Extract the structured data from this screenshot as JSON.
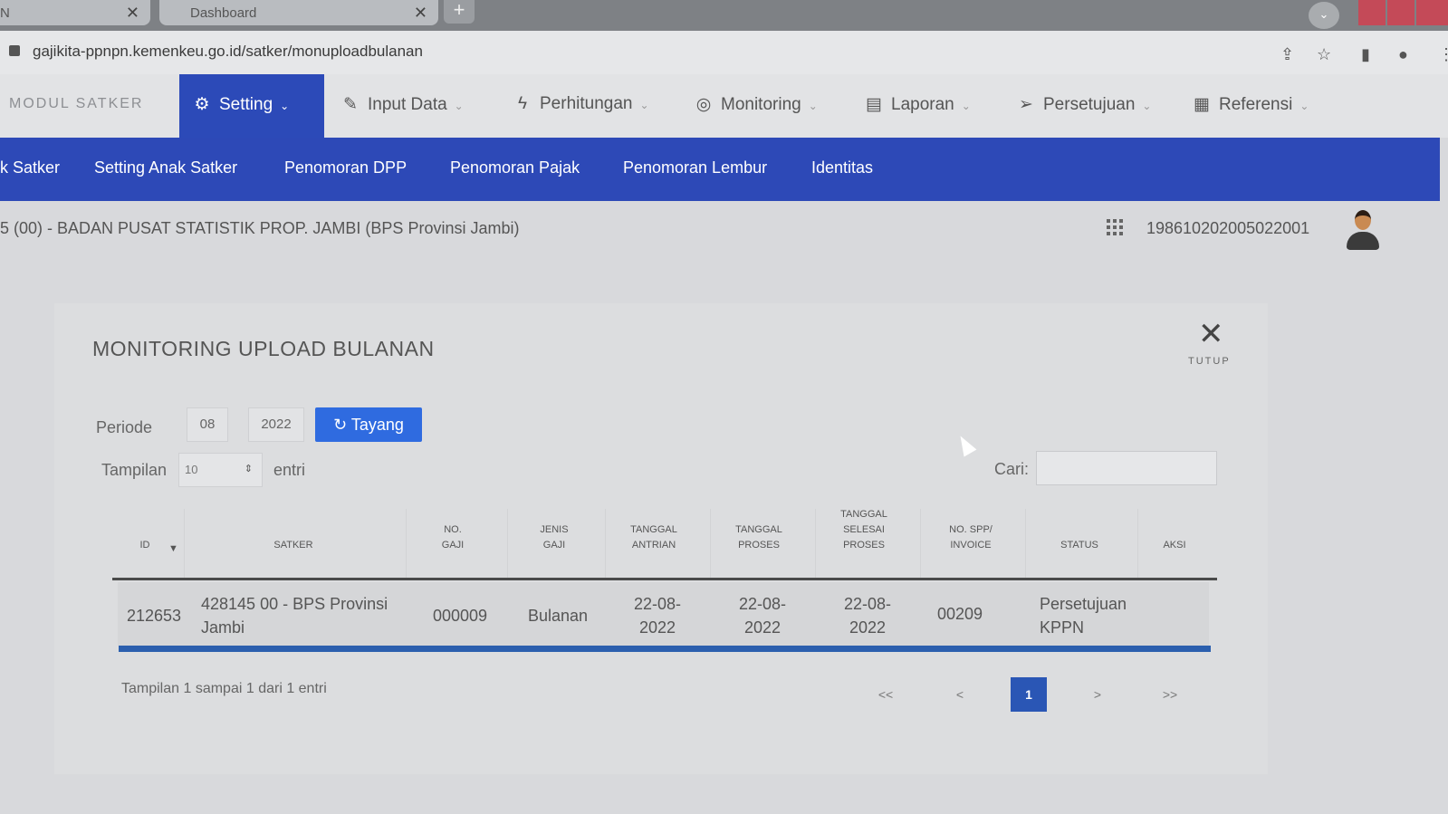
{
  "browser": {
    "tabs": [
      {
        "label": "N"
      },
      {
        "label": "Dashboard"
      }
    ],
    "url": "gajikita-ppnpn.kemenkeu.go.id/satker/monuploadbulanan"
  },
  "mainnav": {
    "brand": "MODUL SATKER",
    "items": [
      {
        "label": "Setting"
      },
      {
        "label": "Input Data"
      },
      {
        "label": "Perhitungan"
      },
      {
        "label": "Monitoring"
      },
      {
        "label": "Laporan"
      },
      {
        "label": "Persetujuan"
      },
      {
        "label": "Referensi"
      }
    ]
  },
  "subnav": {
    "items": [
      {
        "label": "k Satker"
      },
      {
        "label": "Setting Anak Satker"
      },
      {
        "label": "Penomoran DPP"
      },
      {
        "label": "Penomoran Pajak"
      },
      {
        "label": "Penomoran Lembur"
      },
      {
        "label": "Identitas"
      }
    ]
  },
  "info": {
    "satker": "5 (00) - BADAN PUSAT STATISTIK PROP. JAMBI (BPS Provinsi Jambi)",
    "nip": "198610202005022001"
  },
  "modal": {
    "title": "MONITORING UPLOAD BULANAN",
    "close_label": "TUTUP",
    "periode_label": "Periode",
    "bulan": "08",
    "tahun": "2022",
    "tayang_label": "Tayang",
    "tampilan_label": "Tampilan",
    "tampilan_value": "10",
    "entri_label": "entri",
    "cari_label": "Cari:",
    "search_value": ""
  },
  "table": {
    "headers": [
      {
        "l1": "",
        "l2": "",
        "l3": "ID"
      },
      {
        "l1": "",
        "l2": "",
        "l3": "SATKER"
      },
      {
        "l1": "",
        "l2": "NO.",
        "l3": "GAJI"
      },
      {
        "l1": "",
        "l2": "JENIS",
        "l3": "GAJI"
      },
      {
        "l1": "",
        "l2": "TANGGAL",
        "l3": "ANTRIAN"
      },
      {
        "l1": "",
        "l2": "TANGGAL",
        "l3": "PROSES"
      },
      {
        "l1": "TANGGAL",
        "l2": "SELESAI",
        "l3": "PROSES"
      },
      {
        "l1": "",
        "l2": "NO. SPP/",
        "l3": "INVOICE"
      },
      {
        "l1": "",
        "l2": "",
        "l3": "STATUS"
      },
      {
        "l1": "",
        "l2": "",
        "l3": "AKSI"
      }
    ],
    "rows": [
      {
        "id": "212653",
        "satker_1": "428145 00 - BPS Provinsi",
        "satker_2": "Jambi",
        "no_gaji": "000009",
        "jenis_gaji": "Bulanan",
        "tgl_antrian_1": "22-08-",
        "tgl_antrian_2": "2022",
        "tgl_proses_1": "22-08-",
        "tgl_proses_2": "2022",
        "tgl_selesai_1": "22-08-",
        "tgl_selesai_2": "2022",
        "no_spp": "00209",
        "status_1": "Persetujuan",
        "status_2": "KPPN",
        "aksi": ""
      }
    ]
  },
  "footer": {
    "info": "Tampilan 1 sampai 1 dari 1 entri",
    "pagination": {
      "first": "<<",
      "prev": "<",
      "current": "1",
      "next": ">",
      "last": ">>"
    }
  },
  "colors": {
    "primary_nav": "#2d49b7",
    "button": "#2f6be0",
    "page_active": "#2a56b5"
  }
}
